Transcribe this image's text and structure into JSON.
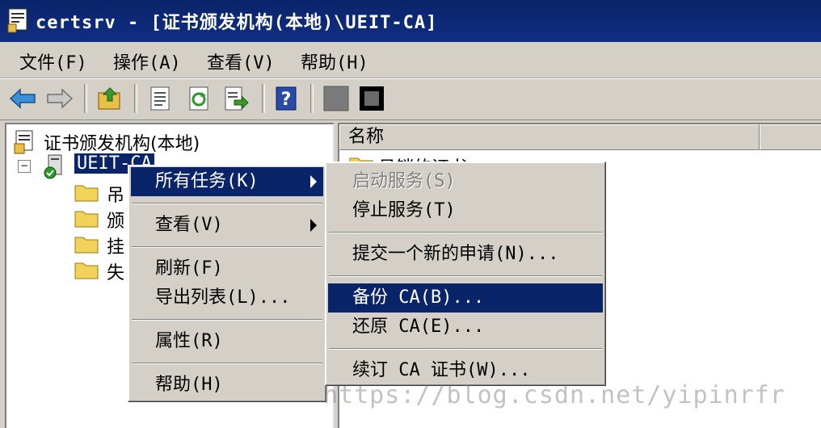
{
  "window": {
    "title": "certsrv - [证书颁发机构(本地)\\UEIT-CA]"
  },
  "menubar": {
    "items": [
      "文件(F)",
      "操作(A)",
      "查看(V)",
      "帮助(H)"
    ]
  },
  "toolbar": {
    "buttons": [
      "back-arrow-icon",
      "forward-arrow-icon",
      "up-folder-icon",
      "properties-icon",
      "refresh-icon",
      "export-list-icon",
      "help-icon",
      "start-service-icon",
      "stop-service-icon"
    ]
  },
  "tree": {
    "root": "证书颁发机构(本地)",
    "ca_node": "UEIT-CA",
    "expander": "−",
    "children": [
      "吊",
      "颁",
      "挂",
      "失"
    ]
  },
  "list": {
    "column_name": "名称",
    "first_item": "吊销的证书"
  },
  "context_menu": {
    "items": [
      {
        "label": "所有任务(K)",
        "selected": true,
        "submenu": true
      },
      {
        "label": "查看(V)",
        "submenu": true
      },
      {
        "label": "刷新(F)"
      },
      {
        "label": "导出列表(L)..."
      },
      {
        "label": "属性(R)"
      },
      {
        "label": "帮助(H)"
      }
    ]
  },
  "submenu": {
    "items": [
      {
        "label": "启动服务(S)",
        "disabled": true
      },
      {
        "label": "停止服务(T)"
      },
      {
        "label": "提交一个新的申请(N)..."
      },
      {
        "label": "备份 CA(B)...",
        "selected": true
      },
      {
        "label": "还原 CA(E)..."
      },
      {
        "label": "续订 CA 证书(W)..."
      }
    ]
  },
  "watermark": "https://blog.csdn.net/yipinrfr",
  "colors": {
    "selection": "#0a246a",
    "titlebar": "#0a246a",
    "face": "#d4d0c8"
  }
}
